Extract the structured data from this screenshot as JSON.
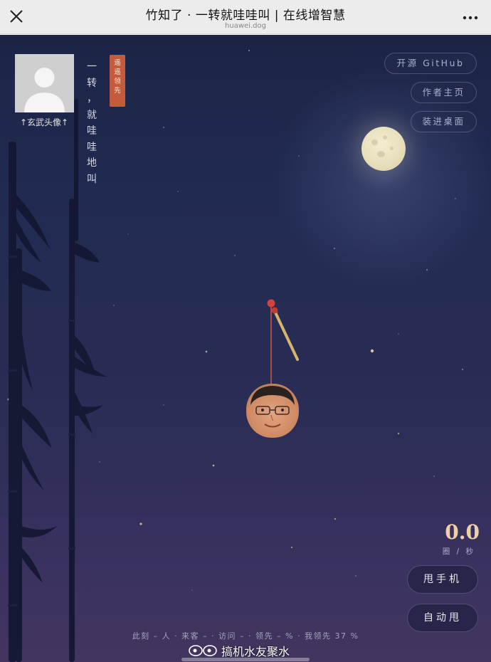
{
  "browser": {
    "title": "竹知了 · 一转就哇哇叫 | 在线增智慧",
    "domain": "huawei.dog",
    "close_icon": "close-icon",
    "more_icon": "more-icon"
  },
  "profile": {
    "avatar_label": "↑玄武头像↑",
    "avatar_icon": "avatar-placeholder-icon"
  },
  "tagline": [
    "一",
    "转",
    "，",
    "就",
    "哇",
    "哇",
    "地",
    "叫"
  ],
  "lead_tag": [
    "遥",
    "遥",
    "领",
    "先"
  ],
  "buttons": {
    "github": "开源 GitHub",
    "author": "作者主页",
    "desktop": "装进桌面",
    "shake": "甩手机",
    "auto": "自动甩"
  },
  "speed": {
    "value": "0.0",
    "unit": "圈 / 秒"
  },
  "stats": {
    "line": "此刻 – 人 · 来客 – · 访问 – · 领先 – % · 我领先 37 %"
  },
  "watermark": {
    "text": "搞机水友聚水"
  },
  "colors": {
    "sky_top": "#1c2446",
    "sky_bottom": "#43355f",
    "moon": "#e8dfbd",
    "speed_value": "#f0cfa6",
    "lead_tag": "#c65a3c"
  }
}
